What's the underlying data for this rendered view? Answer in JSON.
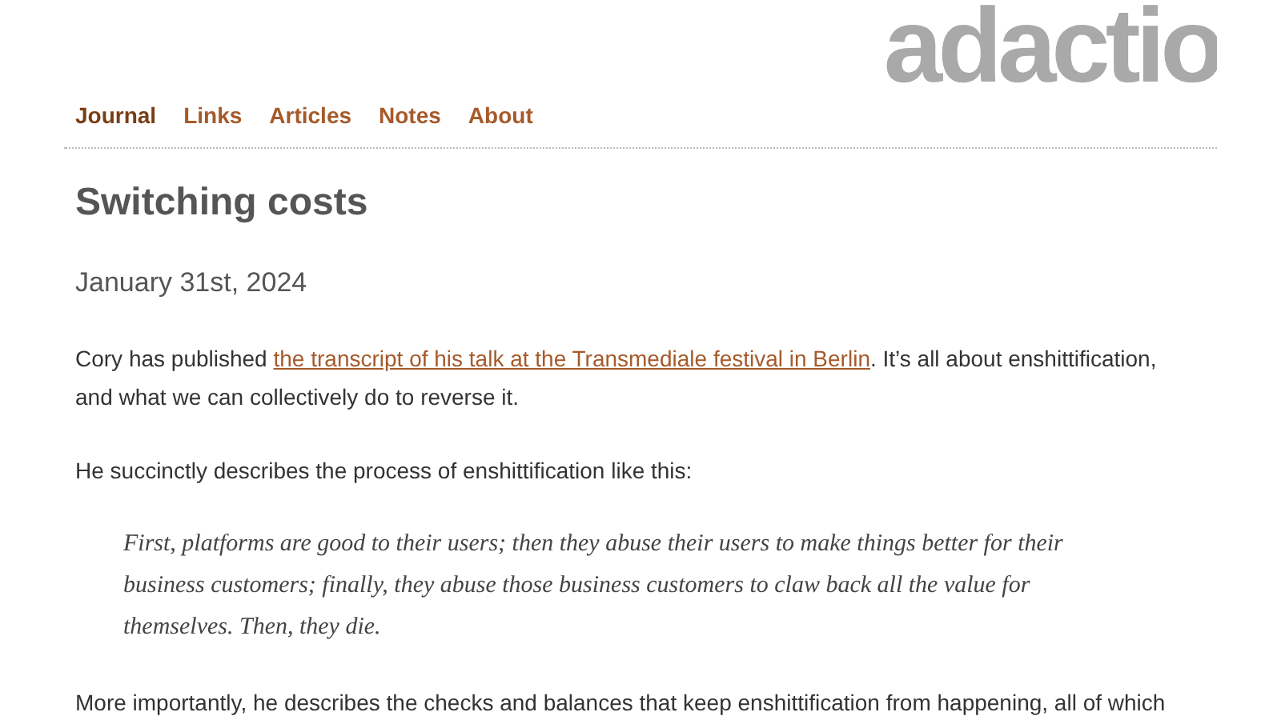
{
  "logo": "adactio",
  "nav": [
    {
      "label": "Journal",
      "selected": true
    },
    {
      "label": "Links",
      "selected": false
    },
    {
      "label": "Articles",
      "selected": false
    },
    {
      "label": "Notes",
      "selected": false
    },
    {
      "label": "About",
      "selected": false
    }
  ],
  "title": "Switching costs",
  "date": "January 31st, 2024",
  "paragraphs": [
    {
      "before": "Cory has published ",
      "link": "the transcript of his talk at the Transmediale festival in Berlin",
      "after": ". It’s all about enshittification, and what we can collectively do to reverse it."
    },
    {
      "before": "He succinctly describes the process of enshittification like this:"
    }
  ],
  "quote": "First, platforms are good to their users; then they abuse their users to make things better for their business customers; finally, they abuse those business customers to claw back all the value for themselves. Then, they die.",
  "last_paragraph": "More importantly, he describes the checks and balances that keep enshittification from happening, all of which"
}
